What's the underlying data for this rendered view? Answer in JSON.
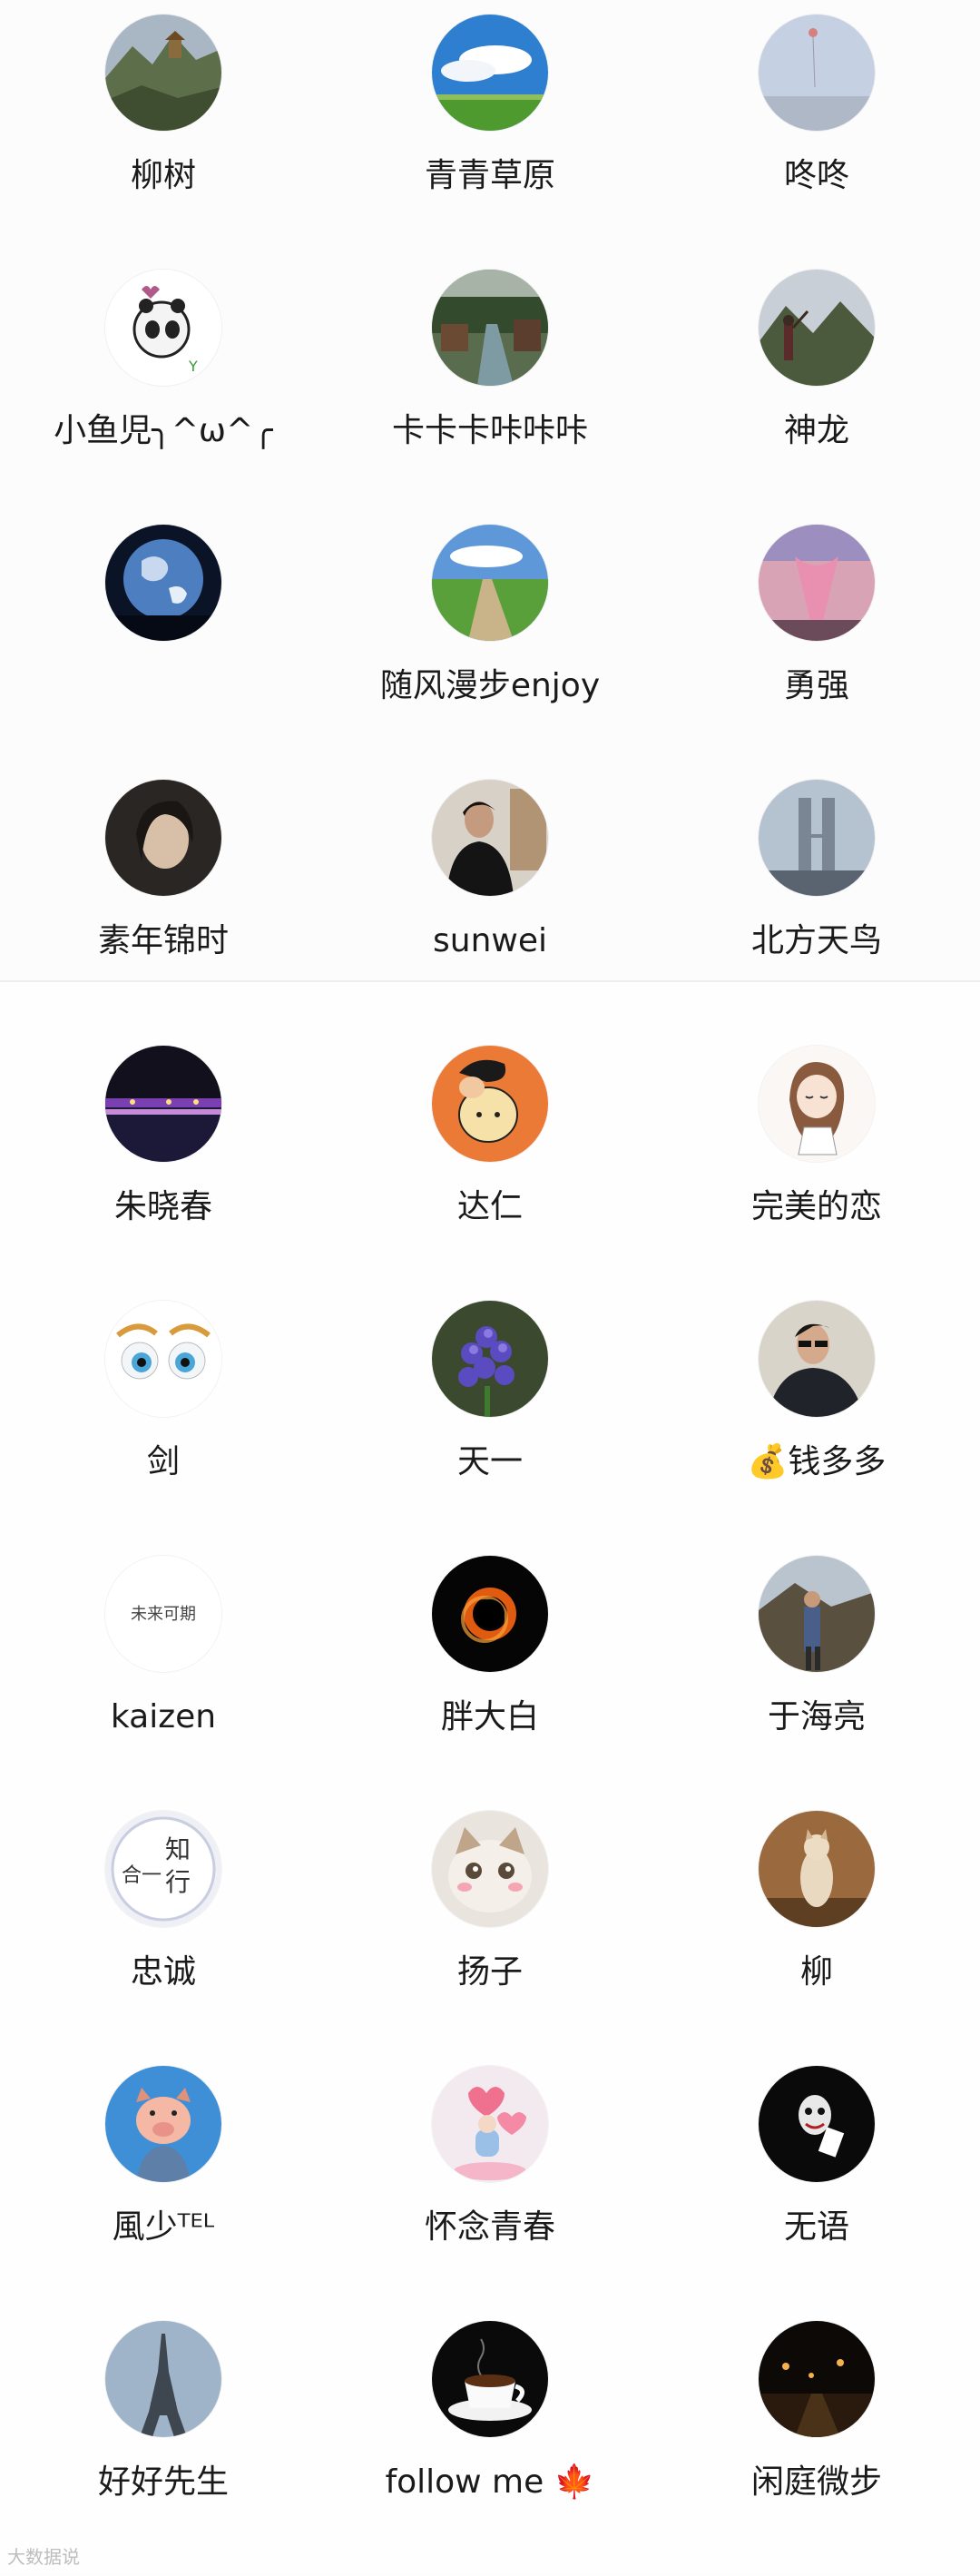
{
  "contacts_top": [
    {
      "name": "柳树",
      "avatar_icon": "mountain-temple-photo"
    },
    {
      "name": "青青草原",
      "avatar_icon": "grassland-sky-photo"
    },
    {
      "name": "咚咚",
      "avatar_icon": "hazy-sky-photo"
    },
    {
      "name": "小鱼児╮^ω^╭",
      "avatar_icon": "cartoon-panda-avatar"
    },
    {
      "name": "卡卡卡咔咔咔",
      "avatar_icon": "river-town-photo"
    },
    {
      "name": "神龙",
      "avatar_icon": "mountain-person-photo"
    },
    {
      "name": "",
      "avatar_icon": "earth-globe-avatar"
    },
    {
      "name": "随风漫步enjoy",
      "avatar_icon": "country-road-photo"
    },
    {
      "name": "勇强",
      "avatar_icon": "pink-tower-photo"
    },
    {
      "name": "素年锦时",
      "avatar_icon": "woman-portrait-photo"
    },
    {
      "name": "sunwei",
      "avatar_icon": "man-portrait-photo"
    },
    {
      "name": "北方天鸟",
      "avatar_icon": "twin-towers-photo"
    }
  ],
  "contacts_bottom": [
    {
      "name": "朱晓春",
      "avatar_icon": "night-bridge-photo"
    },
    {
      "name": "达仁",
      "avatar_icon": "cartoon-boy-avatar"
    },
    {
      "name": "完美的恋",
      "avatar_icon": "cartoon-girl-avatar"
    },
    {
      "name": "剑",
      "avatar_icon": "cartoon-eyes-avatar"
    },
    {
      "name": "天一",
      "avatar_icon": "hyacinth-flower-photo"
    },
    {
      "name": "💰钱多多",
      "avatar_icon": "man-sunglasses-photo"
    },
    {
      "name": "kaizen",
      "avatar_icon": "calligraphy-text-avatar"
    },
    {
      "name": "胖大白",
      "avatar_icon": "black-hole-avatar"
    },
    {
      "name": "于海亮",
      "avatar_icon": "man-outdoor-photo"
    },
    {
      "name": "忠诚",
      "avatar_icon": "calligraphy-seal-avatar"
    },
    {
      "name": "扬子",
      "avatar_icon": "cat-face-photo"
    },
    {
      "name": "柳",
      "avatar_icon": "standing-cat-photo"
    },
    {
      "name": "風少ᵀᴱᴸ",
      "avatar_icon": "cartoon-pig-avatar"
    },
    {
      "name": "怀念青春",
      "avatar_icon": "heart-balloon-avatar"
    },
    {
      "name": "无语",
      "avatar_icon": "joker-card-avatar"
    },
    {
      "name": "好好先生",
      "avatar_icon": "eiffel-tower-photo"
    },
    {
      "name": "follow me 🍁",
      "avatar_icon": "coffee-cup-photo"
    },
    {
      "name": "闲庭微步",
      "avatar_icon": "night-street-photo"
    }
  ],
  "avatar_text": {
    "calligraphy": "未来可期",
    "seal_line1": "知",
    "seal_line2": "行",
    "seal_line3": "合一"
  },
  "watermark": "大数据说"
}
